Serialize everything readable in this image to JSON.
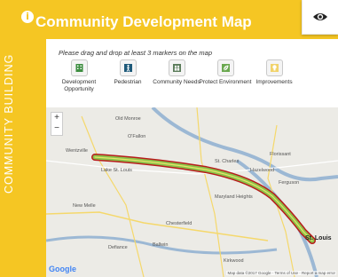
{
  "header": {
    "title": "Community Development Map",
    "info_glyph": "i"
  },
  "sidebar": {
    "label": "COMMUNITY BUILDING"
  },
  "instructions": "Please drag and drop at least 3 markers on the map",
  "markers": [
    {
      "label": "Development Opportunity",
      "icon": "building-icon"
    },
    {
      "label": "Pedestrian",
      "icon": "pedestrian-icon"
    },
    {
      "label": "Community Needs",
      "icon": "community-needs-icon"
    },
    {
      "label": "Protect Environment",
      "icon": "leaf-icon"
    },
    {
      "label": "Improvements",
      "icon": "lightbulb-icon"
    }
  ],
  "map": {
    "zoom_in": "+",
    "zoom_out": "−",
    "places": [
      "Old Monroe",
      "O'Fallon",
      "Wentzville",
      "Lake St. Louis",
      "St. Charles",
      "Florissant",
      "Hazelwood",
      "Maryland Heights",
      "Chesterfield",
      "Ferguson",
      "New Melle",
      "Ballwin",
      "Kirkwood",
      "Defiance"
    ],
    "city": "St. Louis",
    "google": "Google",
    "attribution": "Map data ©2017 Google · Terms of Use · Report a map error"
  },
  "colors": {
    "accent": "#f5c623",
    "route": "#8bc34a",
    "route_edge": "#b71c1c"
  }
}
